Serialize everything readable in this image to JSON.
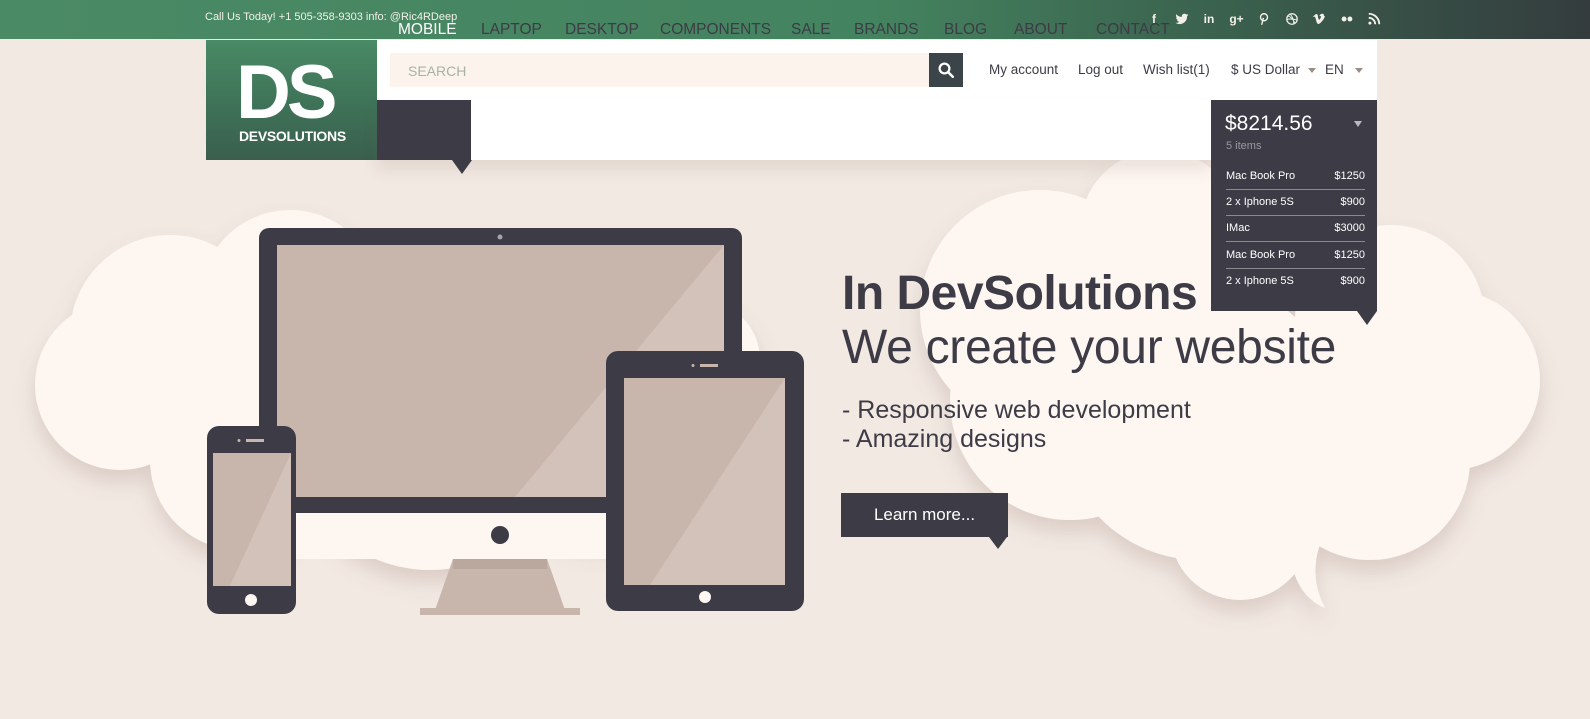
{
  "topbar": {
    "contact_text": "Call Us Today! +1 505-358-9303 info: @Ric4RDeep",
    "social": [
      "facebook-icon",
      "twitter-icon",
      "linkedin-icon",
      "google-plus-icon",
      "pinterest-icon",
      "dribbble-icon",
      "vimeo-icon",
      "flickr-icon",
      "rss-icon"
    ],
    "social_glyphs": {
      "facebook": "f",
      "linkedin": "in",
      "google": "g+"
    }
  },
  "logo": {
    "big": "DS",
    "small": "DEVSOLUTIONS"
  },
  "search": {
    "placeholder": "SEARCH"
  },
  "userlinks": {
    "account": "My account",
    "logout": "Log out",
    "wishlist": "Wish list(1)",
    "currency": "$ US Dollar",
    "language": "EN"
  },
  "nav": {
    "items": [
      "MOBILE",
      "LAPTOP",
      "DESKTOP",
      "COMPONENTS",
      "SALE",
      "BRANDS",
      "BLOG",
      "ABOUT",
      "CONTACT"
    ],
    "active": "MOBILE"
  },
  "cart": {
    "total": "$8214.56",
    "count": "5 items",
    "items": [
      {
        "name": "Mac Book Pro",
        "price": "$1250"
      },
      {
        "name": "2 x Iphone 5S",
        "price": "$900"
      },
      {
        "name": "IMac",
        "price": "$3000"
      },
      {
        "name": "Mac Book Pro",
        "price": "$1250"
      },
      {
        "name": "2 x Iphone 5S",
        "price": "$900"
      }
    ]
  },
  "hero": {
    "title": "In DevSolutions",
    "subtitle": "We create your website",
    "features": [
      "- Responsive web development",
      "- Amazing designs"
    ],
    "button": "Learn more..."
  },
  "colors": {
    "brand_green": "#4a8a65",
    "dark": "#3d3b45",
    "background": "#f2e9e3",
    "cloud": "#fdf6f1",
    "screen": "#c8b6ad"
  }
}
